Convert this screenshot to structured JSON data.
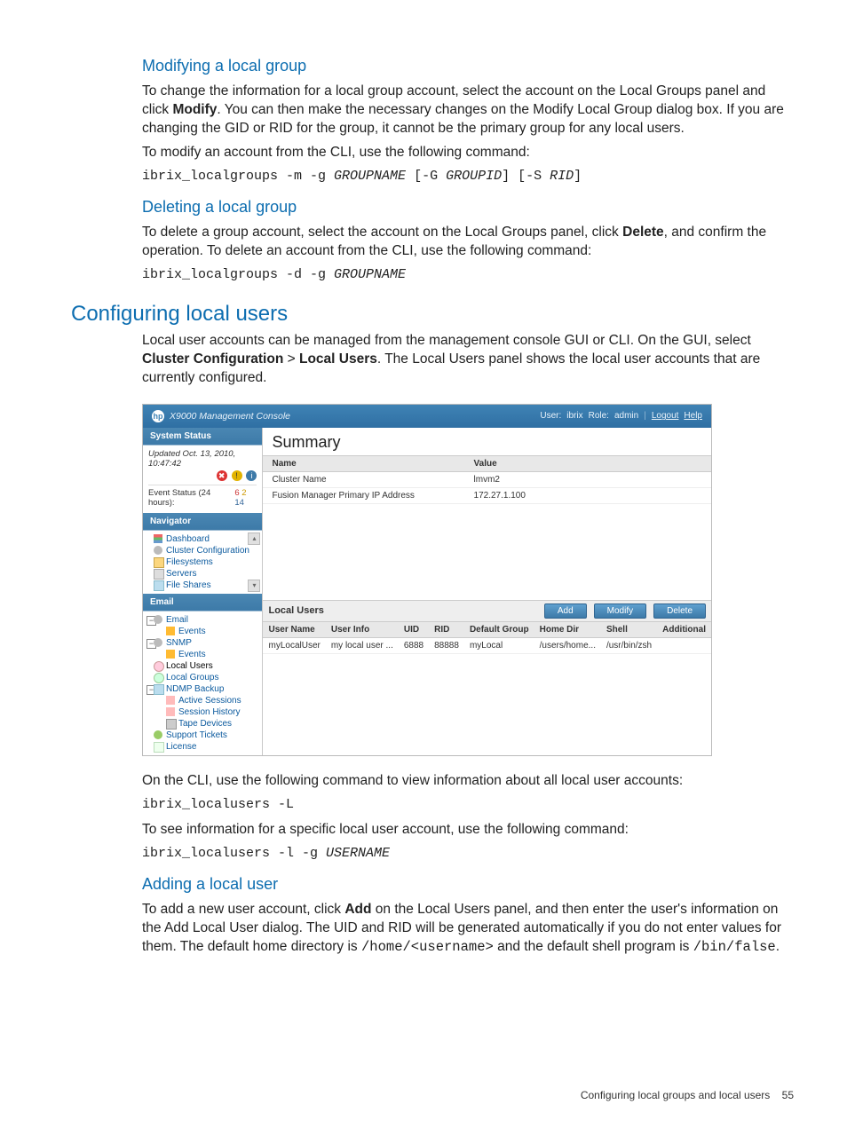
{
  "section1": {
    "title": "Modifying a local group",
    "p1_a": "To change the information for a local group account, select the account on the Local Groups panel and click ",
    "p1_b": "Modify",
    "p1_c": ". You can then make the necessary changes on the Modify Local Group dialog box. If you are changing the GID or RID for the group, it cannot be the primary group for any local users.",
    "p2": "To modify an account from the CLI, use the following command:",
    "cmd_a": "ibrix_localgroups -m -g ",
    "cmd_b": "GROUPNAME",
    "cmd_c": " [-G ",
    "cmd_d": "GROUPID",
    "cmd_e": "] [-S ",
    "cmd_f": "RID",
    "cmd_g": "]"
  },
  "section2": {
    "title": "Deleting a local group",
    "p1_a": "To delete a group account, select the account on the Local Groups panel, click ",
    "p1_b": "Delete",
    "p1_c": ", and confirm the operation. To delete an account from the CLI, use the following command:",
    "cmd_a": "ibrix_localgroups -d -g ",
    "cmd_b": "GROUPNAME"
  },
  "section3": {
    "title": "Configuring local users",
    "p1_a": "Local user accounts can be managed from the management console GUI or CLI. On the GUI, select ",
    "p1_b": "Cluster Configuration",
    "p1_c": " > ",
    "p1_d": "Local Users",
    "p1_e": ". The Local Users panel shows the local user accounts that are currently configured."
  },
  "figure": {
    "titlebar": {
      "title": "X9000 Management Console",
      "user_lbl": "User:",
      "user": "ibrix",
      "role_lbl": "Role:",
      "role": "admin",
      "logout": "Logout",
      "help": "Help"
    },
    "status": {
      "head": "System Status",
      "updated": "Updated Oct. 13, 2010, 10:47:42",
      "row_label": "Event Status (24 hours):",
      "n1": "6",
      "n2": "2",
      "n3": "14"
    },
    "navigator_head": "Navigator",
    "nav": {
      "dashboard": "Dashboard",
      "cluster_config": "Cluster Configuration",
      "filesystems": "Filesystems",
      "servers": "Servers",
      "file_shares": "File Shares"
    },
    "email_head": "Email",
    "tree": {
      "email": "Email",
      "events": "Events",
      "snmp": "SNMP",
      "events2": "Events",
      "local_users": "Local Users",
      "local_groups": "Local Groups",
      "ndmp": "NDMP Backup",
      "active_sessions": "Active Sessions",
      "session_history": "Session History",
      "tape_devices": "Tape Devices",
      "support_tickets": "Support Tickets",
      "license": "License"
    },
    "summary": {
      "title": "Summary",
      "col_name": "Name",
      "col_value": "Value",
      "r1n": "Cluster Name",
      "r1v": "lmvm2",
      "r2n": "Fusion Manager Primary IP Address",
      "r2v": "172.27.1.100"
    },
    "local_users": {
      "panel_title": "Local Users",
      "btn_add": "Add",
      "btn_modify": "Modify",
      "btn_delete": "Delete",
      "cols": {
        "username": "User Name",
        "userinfo": "User Info",
        "uid": "UID",
        "rid": "RID",
        "defgroup": "Default Group",
        "homedir": "Home Dir",
        "shell": "Shell",
        "additional": "Additional"
      },
      "row": {
        "username": "myLocalUser",
        "userinfo": "my local user ...",
        "uid": "6888",
        "rid": "88888",
        "defgroup": "myLocal",
        "homedir": "/users/home...",
        "shell": "/usr/bin/zsh",
        "additional": ""
      }
    }
  },
  "after": {
    "p1": "On the CLI, use the following command to view information about all local user accounts:",
    "cmd1": "ibrix_localusers -L",
    "p2": "To see information for a specific local user account, use the following command:",
    "cmd2_a": "ibrix_localusers -l -g ",
    "cmd2_b": "USERNAME"
  },
  "section4": {
    "title": "Adding a local user",
    "p_a": "To add a new user account, click ",
    "p_b": "Add",
    "p_c": " on the Local Users panel, and then enter the user's information on the Add Local User dialog. The UID and RID will be generated automatically if you do not enter values for them. The default home directory is ",
    "p_d": "/home/<username>",
    "p_e": " and the default shell program is ",
    "p_f": "/bin/false",
    "p_g": "."
  },
  "footer": {
    "text": "Configuring local groups and local users",
    "page": "55"
  }
}
